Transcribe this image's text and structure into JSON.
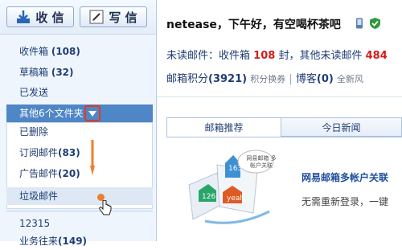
{
  "toolbar": {
    "receive_label": "收 信",
    "write_label": "写 信"
  },
  "folders": [
    {
      "label": "收件箱",
      "count": "(108)"
    },
    {
      "label": "草稿箱",
      "count": "(32)"
    },
    {
      "label": "已发送",
      "count": ""
    }
  ],
  "other_folders_label": "其他6个文件夹",
  "subfolders": [
    {
      "label": "已删除",
      "count": ""
    },
    {
      "label": "订阅邮件",
      "count": "(83)"
    },
    {
      "label": "广告邮件",
      "count": "(20)"
    },
    {
      "label": "垃圾邮件",
      "count": ""
    }
  ],
  "bottom_folders": [
    {
      "label": "12315",
      "count": ""
    },
    {
      "label": "业务往来",
      "count": "(149)"
    }
  ],
  "main": {
    "greeting": "netease，下午好，有空喝杯茶吧",
    "unread_prefix": "未读邮件：",
    "inbox_link": "收件箱",
    "inbox_unread": "108",
    "unit1": "封，",
    "other_unread_link": "其他未读邮件",
    "other_unread": "484",
    "score_label": "邮箱积分",
    "score_value": "(3921)",
    "score_sub": "积分换券",
    "blog_label": "博客",
    "blog_value": "(0)",
    "blog_sub": "全新风"
  },
  "tabs": {
    "recommend": "邮箱推荐",
    "news": "今日新闻"
  },
  "promo": {
    "title": "网易邮箱多帐户关联",
    "desc": "无需重新登录，一键",
    "badges": [
      "163",
      "126",
      "yeah"
    ],
    "bubble": "网易邮箱 多帐户关联"
  },
  "colors": {
    "accent": "#4f86c6",
    "red": "#d21c1c",
    "orange": "#f07f2b",
    "highlight_border": "#e23a1f"
  }
}
